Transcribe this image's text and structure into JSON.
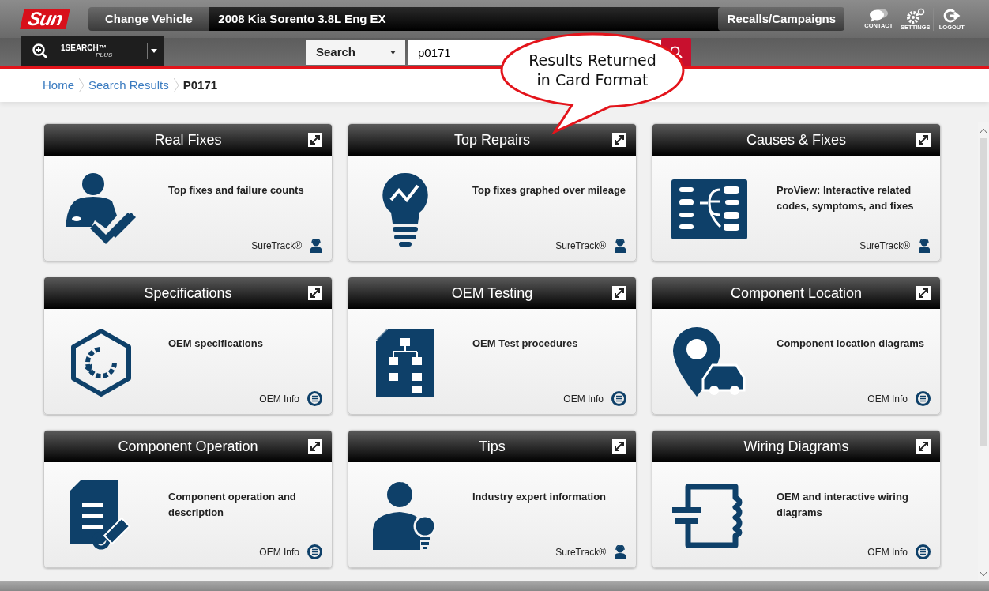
{
  "logo": "Sun",
  "header": {
    "change_vehicle": "Change Vehicle",
    "vehicle": "2008 Kia Sorento 3.8L Eng EX",
    "recalls": "Recalls/Campaigns",
    "tools": [
      {
        "label": "CONTACT"
      },
      {
        "label": "SETTINGS"
      },
      {
        "label": "LOGOUT"
      }
    ]
  },
  "search_bar": {
    "product": "1SEARCH™",
    "product_sub": "PLUS",
    "scope": "Search",
    "query": "p0171"
  },
  "breadcrumb": [
    {
      "label": "Home",
      "kind": "link"
    },
    {
      "label": "Search Results",
      "kind": "link"
    },
    {
      "label": "P0171",
      "kind": "current"
    }
  ],
  "callout": {
    "text": "Results Returned in Card Format"
  },
  "cards": [
    {
      "title": "Real Fixes",
      "description": "Top fixes and failure counts",
      "source": "SureTrack®",
      "kind": "suretrack"
    },
    {
      "title": "Top Repairs",
      "description": "Top fixes graphed over mileage",
      "source": "SureTrack®",
      "kind": "suretrack"
    },
    {
      "title": "Causes & Fixes",
      "description": "ProView: Interactive related codes, symptoms, and fixes",
      "source": "SureTrack®",
      "kind": "suretrack"
    },
    {
      "title": "Specifications",
      "description": "OEM specifications",
      "source": "OEM Info",
      "kind": "oem"
    },
    {
      "title": "OEM Testing",
      "description": "OEM Test procedures",
      "source": "OEM Info",
      "kind": "oem"
    },
    {
      "title": "Component Location",
      "description": "Component location diagrams",
      "source": "OEM Info",
      "kind": "oem"
    },
    {
      "title": "Component Operation",
      "description": "Component operation and description",
      "source": "OEM Info",
      "kind": "oem"
    },
    {
      "title": "Tips",
      "description": "Industry expert information",
      "source": "SureTrack®",
      "kind": "suretrack"
    },
    {
      "title": "Wiring Diagrams",
      "description": "OEM and interactive wiring diagrams",
      "source": "OEM Info",
      "kind": "oem"
    }
  ]
}
